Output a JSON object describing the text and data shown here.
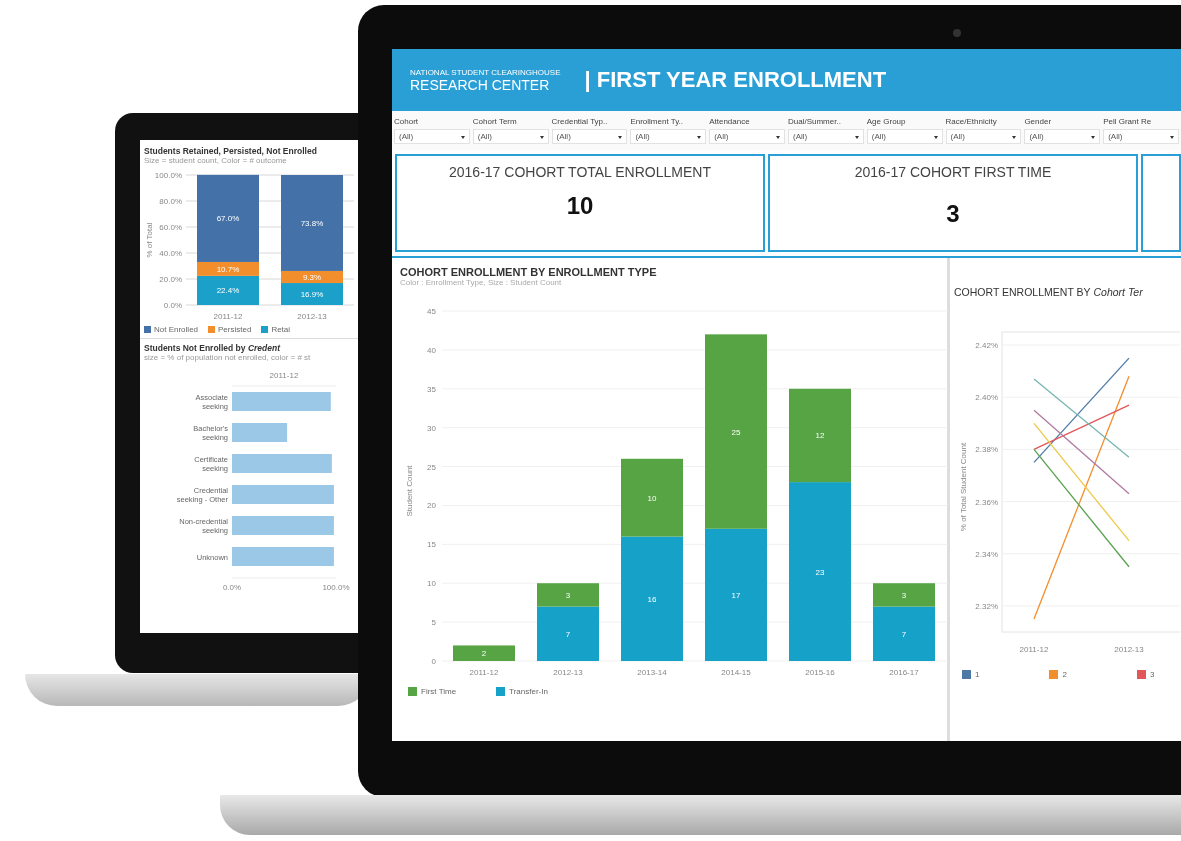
{
  "back_screen": {
    "retention_panel": {
      "title": "Students Retained, Persisted, Not Enrolled",
      "subtitle": "Size = student count, Color = # outcome",
      "chart_data": {
        "type": "bar",
        "stacked": true,
        "grid": true,
        "ylabel": "% of Total",
        "categories": [
          "2011-12",
          "2012-13"
        ],
        "ylim": [
          0,
          100
        ],
        "yticks": [
          {
            "value": 0,
            "label": "0.0%"
          },
          {
            "value": 20,
            "label": "20.0%"
          },
          {
            "value": 40,
            "label": "40.0%"
          },
          {
            "value": 60,
            "label": "60.0%"
          },
          {
            "value": 80,
            "label": "80.0%"
          },
          {
            "value": 100,
            "label": "100.0%"
          }
        ],
        "series": [
          {
            "name": "Retai",
            "color": "#1ba1c9",
            "values": [
              22.4,
              16.9
            ]
          },
          {
            "name": "Persisted",
            "color": "#f28e2b",
            "values": [
              10.7,
              9.3
            ]
          },
          {
            "name": "Not Enrolled",
            "color": "#4472a8",
            "values": [
              67.0,
              73.8
            ]
          }
        ],
        "value_labels": [
          [
            "22.4%",
            "16.9%"
          ],
          [
            "10.7%",
            "9.3%"
          ],
          [
            "67.0%",
            "73.8%"
          ]
        ]
      }
    },
    "credential_panel": {
      "title": "Students Not Enrolled by",
      "title_italic": "Credent",
      "subtitle": "size = % of population not enrolled, color = # st",
      "chart_data": {
        "type": "bar",
        "orientation": "horizontal",
        "title": "2011-12",
        "categories": [
          "Associate seeking",
          "Bachelor's seeking",
          "Certificate seeking",
          "Credential seeking - Other",
          "Non-credential seeking",
          "Unknown"
        ],
        "xlim": [
          0,
          100
        ],
        "xticks": [
          {
            "value": 0,
            "label": "0.0%"
          },
          {
            "value": 100,
            "label": "100.0%"
          }
        ],
        "series": [
          {
            "color": "#9cc8e8",
            "values": [
              95,
              53,
              96,
              98,
              98,
              98
            ]
          }
        ]
      }
    }
  },
  "front_screen": {
    "header": {
      "org_line": "NATIONAL STUDENT CLEARINGHOUSE",
      "org_name": "RESEARCH CENTER",
      "title": "| FIRST YEAR ENROLLMENT"
    },
    "filters": [
      {
        "label": "Cohort",
        "value": "(All)"
      },
      {
        "label": "Cohort Term",
        "value": "(All)"
      },
      {
        "label": "Credential Typ..",
        "value": "(All)"
      },
      {
        "label": "Enrollment Ty..",
        "value": "(All)"
      },
      {
        "label": "Attendance",
        "value": "(All)"
      },
      {
        "label": "Dual/Summer..",
        "value": "(All)"
      },
      {
        "label": "Age Group",
        "value": "(All)"
      },
      {
        "label": "Race/Ethnicity",
        "value": "(All)"
      },
      {
        "label": "Gender",
        "value": "(All)"
      },
      {
        "label": "Pell Grant Re",
        "value": "(All)"
      }
    ],
    "kpis": [
      {
        "title": "2016-17 COHORT TOTAL ENROLLMENT",
        "value": "10"
      },
      {
        "title": "2016-17 COHORT FIRST TIME",
        "value": "3"
      }
    ],
    "bar_chart": {
      "title": "COHORT ENROLLMENT BY ENROLLMENT TYPE",
      "subtitle": "Color : Enrollment Type, Size : Student Count",
      "chart_data": {
        "type": "bar",
        "stacked": true,
        "grid": true,
        "ylabel": "Student Count",
        "categories": [
          "2011-12",
          "2012-13",
          "2013-14",
          "2014-15",
          "2015-16",
          "2016-17"
        ],
        "ylim": [
          0,
          45
        ],
        "yticks": [
          0,
          5,
          10,
          15,
          20,
          25,
          30,
          35,
          40,
          45
        ],
        "series": [
          {
            "name": "Transfer-In",
            "color": "#16a2c8",
            "values": [
              null,
              7,
              16,
              17,
              23,
              7
            ]
          },
          {
            "name": "First Time",
            "color": "#56a444",
            "values": [
              2,
              3,
              10,
              25,
              12,
              3
            ]
          }
        ],
        "data_labels": true
      }
    },
    "line_chart": {
      "title": "COHORT ENROLLMENT BY",
      "title_italic": "Cohort Ter",
      "chart_data": {
        "type": "line",
        "grid": true,
        "ylabel": "% of Total Student Count",
        "x": [
          "2011-12",
          "2012-13"
        ],
        "ylim": [
          2.31,
          2.425
        ],
        "yticks": [
          {
            "value": 2.32,
            "label": "2.32%"
          },
          {
            "value": 2.34,
            "label": "2.34%"
          },
          {
            "value": 2.36,
            "label": "2.36%"
          },
          {
            "value": 2.38,
            "label": "2.38%"
          },
          {
            "value": 2.4,
            "label": "2.40%"
          },
          {
            "value": 2.42,
            "label": "2.42%"
          }
        ],
        "series": [
          {
            "name": "1",
            "color": "#4e79a7",
            "values": [
              2.375,
              2.415
            ]
          },
          {
            "name": "2",
            "color": "#f28e2b",
            "values": [
              2.315,
              2.408
            ]
          },
          {
            "name": "3",
            "color": "#e15759",
            "values": [
              2.38,
              2.397
            ]
          },
          {
            "color": "#76b7b2",
            "values": [
              2.407,
              2.377
            ]
          },
          {
            "color": "#b07aa1",
            "values": [
              2.395,
              2.363
            ]
          },
          {
            "color": "#edc948",
            "values": [
              2.39,
              2.345
            ]
          },
          {
            "color": "#59a14f",
            "values": [
              2.38,
              2.335
            ]
          }
        ]
      }
    }
  }
}
